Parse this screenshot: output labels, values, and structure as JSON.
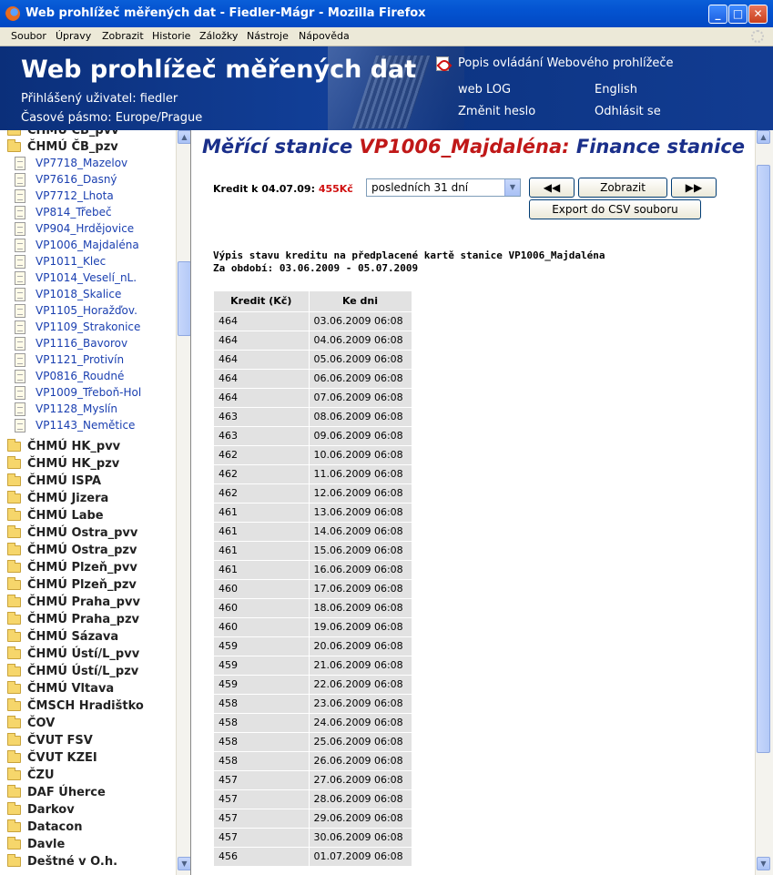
{
  "window": {
    "title": "Web prohlížeč měřených dat - Fiedler-Mágr - Mozilla Firefox"
  },
  "menu": [
    "Soubor",
    "Úpravy",
    "Zobrazit",
    "Historie",
    "Záložky",
    "Nástroje",
    "Nápověda"
  ],
  "header": {
    "app_title": "Web prohlížeč měřených dat",
    "user": "Přihlášený uživatel: fiedler",
    "timezone": "Časové pásmo: Europe/Prague",
    "help_link": "Popis ovládání Webového prohlížeče",
    "weblog_link": "web LOG",
    "english_link": "English",
    "password_link": "Změnit heslo",
    "logout_link": "Odhlásit se"
  },
  "sidebar": {
    "top_partial": "ČHMÚ ČB_pvv",
    "open_group": "ČHMÚ ČB_pzv",
    "stations": [
      "VP7718_Mazelov",
      "VP7616_Dasný",
      "VP7712_Lhota",
      "VP814_Třebeč",
      "VP904_Hrdějovice",
      "VP1006_Majdaléna",
      "VP1011_Klec",
      "VP1014_Veselí_nL.",
      "VP1018_Skalice",
      "VP1105_Horažďov.",
      "VP1109_Strakonice",
      "VP1116_Bavorov",
      "VP1121_Protivín",
      "VP0816_Roudné",
      "VP1009_Třeboň-Hol",
      "VP1128_Myslín",
      "VP1143_Nemětice"
    ],
    "groups": [
      "ČHMÚ HK_pvv",
      "ČHMÚ HK_pzv",
      "ČHMÚ ISPA",
      "ČHMÚ Jizera",
      "ČHMÚ Labe",
      "ČHMÚ Ostra_pvv",
      "ČHMÚ Ostra_pzv",
      "ČHMÚ Plzeň_pvv",
      "ČHMÚ Plzeň_pzv",
      "ČHMÚ Praha_pvv",
      "ČHMÚ Praha_pzv",
      "ČHMÚ Sázava",
      "ČHMÚ Ústí/L_pvv",
      "ČHMÚ Ústí/L_pzv",
      "ČHMÚ Vltava",
      "ČMSCH Hradištko",
      "ČOV",
      "ČVUT FSV",
      "ČVUT KZEI",
      "ČZU",
      "DAF Úherce",
      "Darkov",
      "Datacon",
      "Davle",
      "Deštné v O.h."
    ]
  },
  "main": {
    "title_prefix": "Měřící stanice",
    "station": "VP1006_Majdaléna:",
    "title_suffix": "Finance stanice",
    "credit_label": "Kredit k 04.07.09:",
    "credit_value": "455Kč",
    "period_select": "posledních 31 dní",
    "btn_prev": "◀◀",
    "btn_show": "Zobrazit",
    "btn_next": "▶▶",
    "btn_export": "Export do CSV souboru",
    "desc_line1": "Výpis stavu kreditu na předplacené kartě stanice VP1006_Majdaléna",
    "desc_line2": "Za období: 03.06.2009 - 05.07.2009",
    "table": {
      "col1": "Kredit (Kč)",
      "col2": "Ke dni",
      "rows": [
        [
          "464",
          "03.06.2009 06:08"
        ],
        [
          "464",
          "04.06.2009 06:08"
        ],
        [
          "464",
          "05.06.2009 06:08"
        ],
        [
          "464",
          "06.06.2009 06:08"
        ],
        [
          "464",
          "07.06.2009 06:08"
        ],
        [
          "463",
          "08.06.2009 06:08"
        ],
        [
          "463",
          "09.06.2009 06:08"
        ],
        [
          "462",
          "10.06.2009 06:08"
        ],
        [
          "462",
          "11.06.2009 06:08"
        ],
        [
          "462",
          "12.06.2009 06:08"
        ],
        [
          "461",
          "13.06.2009 06:08"
        ],
        [
          "461",
          "14.06.2009 06:08"
        ],
        [
          "461",
          "15.06.2009 06:08"
        ],
        [
          "461",
          "16.06.2009 06:08"
        ],
        [
          "460",
          "17.06.2009 06:08"
        ],
        [
          "460",
          "18.06.2009 06:08"
        ],
        [
          "460",
          "19.06.2009 06:08"
        ],
        [
          "459",
          "20.06.2009 06:08"
        ],
        [
          "459",
          "21.06.2009 06:08"
        ],
        [
          "459",
          "22.06.2009 06:08"
        ],
        [
          "458",
          "23.06.2009 06:08"
        ],
        [
          "458",
          "24.06.2009 06:08"
        ],
        [
          "458",
          "25.06.2009 06:08"
        ],
        [
          "458",
          "26.06.2009 06:08"
        ],
        [
          "457",
          "27.06.2009 06:08"
        ],
        [
          "457",
          "28.06.2009 06:08"
        ],
        [
          "457",
          "29.06.2009 06:08"
        ],
        [
          "457",
          "30.06.2009 06:08"
        ],
        [
          "456",
          "01.07.2009 06:08"
        ]
      ]
    }
  }
}
